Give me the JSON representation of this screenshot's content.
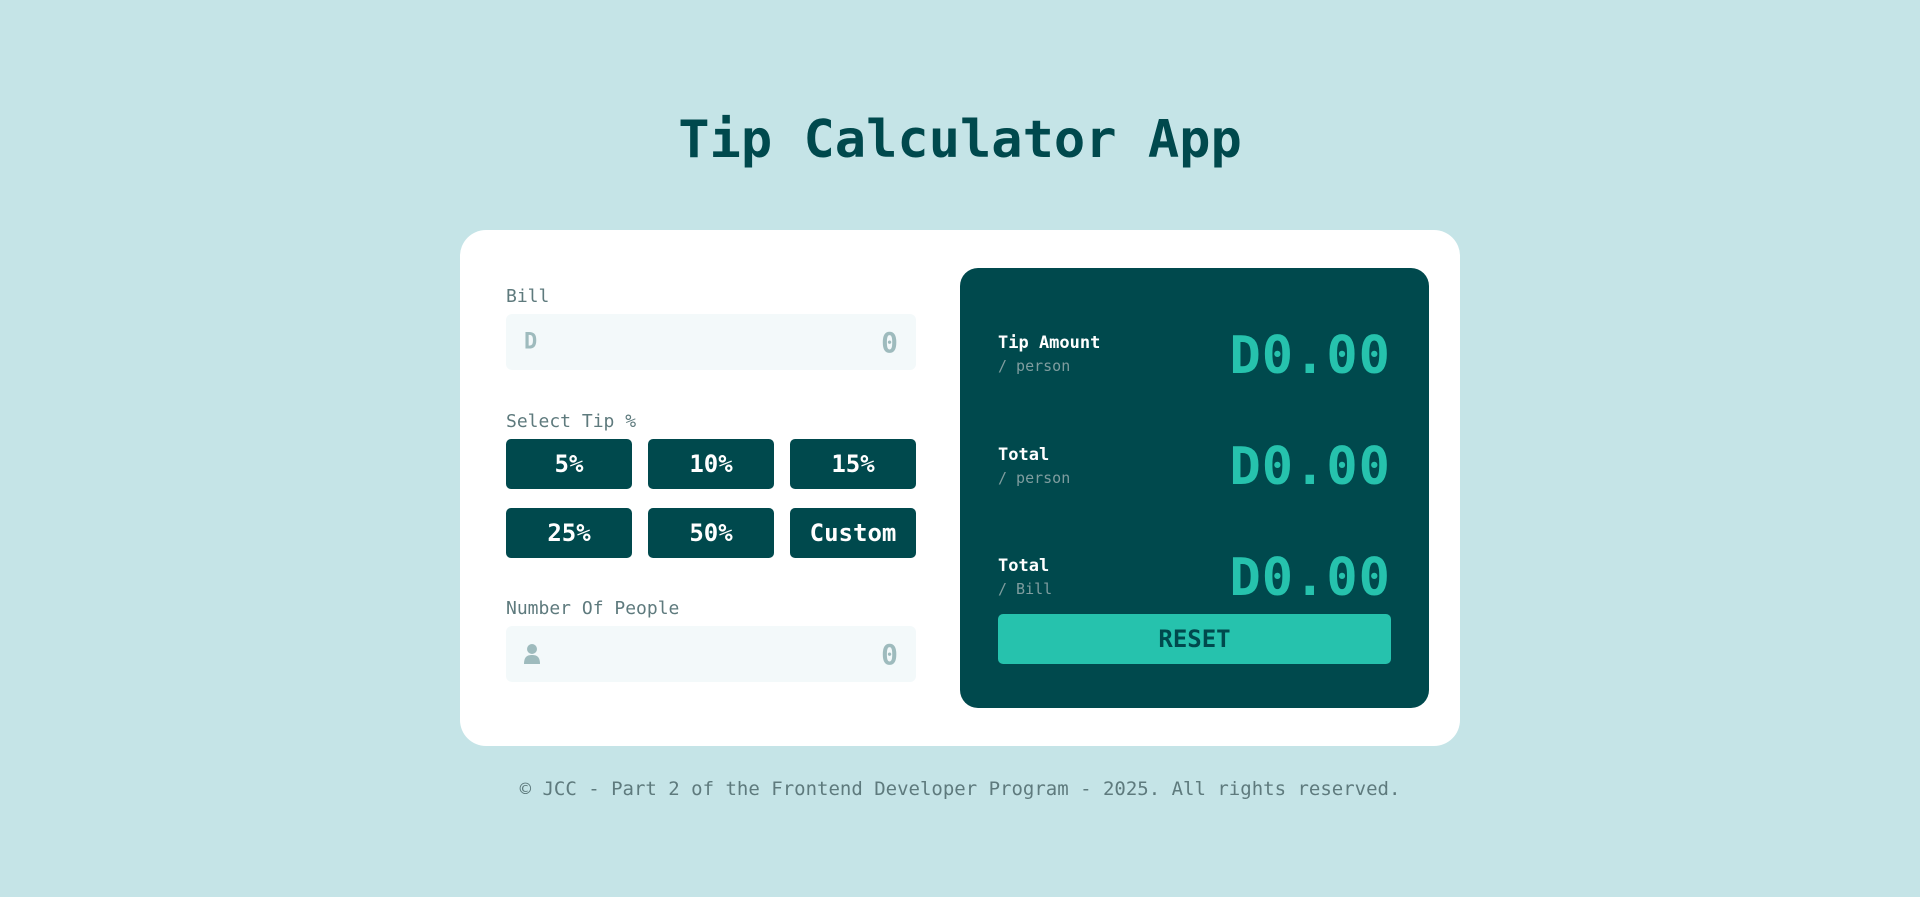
{
  "app": {
    "title": "Tip Calculator App"
  },
  "form": {
    "bill_label": "Bill",
    "bill_prefix": "D",
    "bill_placeholder": "0",
    "tip_label": "Select Tip %",
    "tip_options": [
      "5%",
      "10%",
      "15%",
      "25%",
      "50%",
      "Custom"
    ],
    "people_label": "Number Of People",
    "people_icon": "person-icon",
    "people_placeholder": "0"
  },
  "results": {
    "rows": [
      {
        "label": "Tip Amount",
        "sub": "/ person",
        "value": "D0.00"
      },
      {
        "label": "Total",
        "sub": "/ person",
        "value": "D0.00"
      },
      {
        "label": "Total",
        "sub": "/ Bill",
        "value": "D0.00"
      }
    ],
    "reset_label": "RESET"
  },
  "footer": {
    "text": "© JCC - Part 2 of the Frontend Developer Program - 2025. All rights reserved."
  },
  "colors": {
    "background": "#c5e4e7",
    "dark_teal": "#00494d",
    "accent": "#26c2ad",
    "input_bg": "#f3f9fa",
    "muted": "#5e7a7d"
  }
}
